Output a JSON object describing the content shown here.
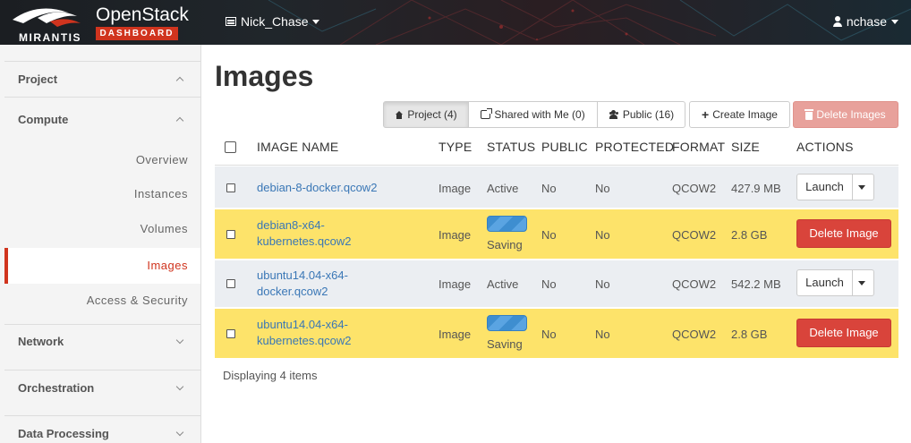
{
  "brand": {
    "logo_text": "MIRANTIS",
    "title": "OpenStack",
    "subtitle": "DASHBOARD"
  },
  "header": {
    "project": "Nick_Chase",
    "user": "nchase"
  },
  "sidebar": {
    "sections": [
      {
        "label": "Project",
        "expanded": true
      },
      {
        "label": "Compute",
        "expanded": true
      },
      {
        "label": "Network",
        "expanded": false
      },
      {
        "label": "Orchestration",
        "expanded": false
      },
      {
        "label": "Data Processing",
        "expanded": false
      }
    ],
    "items": [
      "Overview",
      "Instances",
      "Volumes",
      "Images",
      "Access & Security"
    ],
    "active_item": "Images"
  },
  "page": {
    "title": "Images"
  },
  "toolbar": {
    "filters": [
      "Project (4)",
      "Shared with Me (0)",
      "Public (16)"
    ],
    "create_label": "Create Image",
    "delete_label": "Delete Images"
  },
  "table": {
    "columns": [
      "IMAGE NAME",
      "TYPE",
      "STATUS",
      "PUBLIC",
      "PROTECTED",
      "FORMAT",
      "SIZE",
      "ACTIONS"
    ],
    "rows": [
      {
        "name": [
          "debian-8-docker.qcow2"
        ],
        "type": "Image",
        "status": "Active",
        "public": "No",
        "protected": "No",
        "format": "QCOW2",
        "size": "427.9 MB",
        "action": "Launch"
      },
      {
        "name": [
          "debian8-x64-",
          "kubernetes.qcow2"
        ],
        "type": "Image",
        "status": "Saving",
        "public": "No",
        "protected": "No",
        "format": "QCOW2",
        "size": "2.8 GB",
        "action": "Delete Image"
      },
      {
        "name": [
          "ubuntu14.04-x64-",
          "docker.qcow2"
        ],
        "type": "Image",
        "status": "Active",
        "public": "No",
        "protected": "No",
        "format": "QCOW2",
        "size": "542.2 MB",
        "action": "Launch"
      },
      {
        "name": [
          "ubuntu14.04-x64-",
          "kubernetes.qcow2"
        ],
        "type": "Image",
        "status": "Saving",
        "public": "No",
        "protected": "No",
        "format": "QCOW2",
        "size": "2.8 GB",
        "action": "Delete Image"
      }
    ],
    "footer": "Displaying 4 items"
  },
  "colors": {
    "accent": "#d0341e",
    "saving_row": "#fde36a",
    "normal_row": "#ebeef2",
    "link": "#3a77b6",
    "danger": "#d9443b"
  }
}
